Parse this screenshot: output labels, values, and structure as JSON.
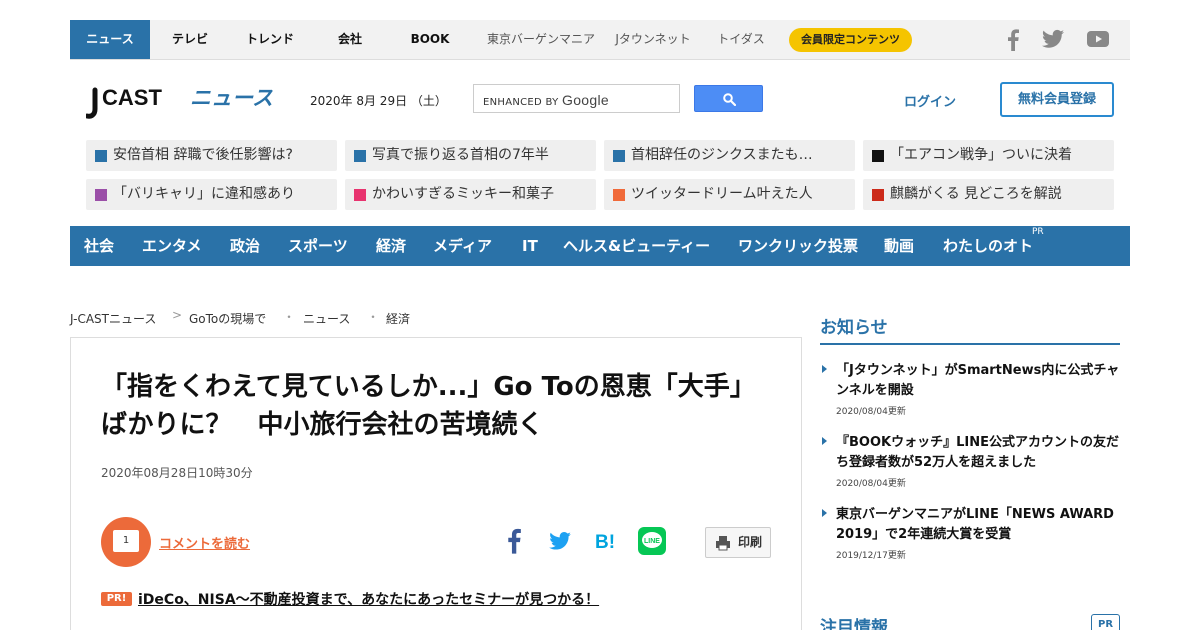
{
  "topnav": {
    "tabs": [
      "ニュース",
      "テレビ",
      "トレンド",
      "会社",
      "BOOK"
    ],
    "sites": [
      "東京バーゲンマニア",
      "Jタウンネット",
      "トイダス"
    ],
    "member_label": "会員限定コンテンツ",
    "social_icons": [
      "facebook-icon",
      "twitter-icon",
      "youtube-icon"
    ]
  },
  "header": {
    "logo_text": "CAST",
    "logo_suffix": "ニュース",
    "date": "2020年 8月 29日 （土）",
    "search_placeholder": "ENHANCED BY",
    "search_brand": "Google",
    "login": "ログイン",
    "register": "無料会員登録"
  },
  "topics": [
    {
      "label": "安倍首相 辞職で後任影響は?",
      "color": "#2a72a8"
    },
    {
      "label": "写真で振り返る首相の7年半",
      "color": "#2a72a8"
    },
    {
      "label": "首相辞任のジンクスまたも…",
      "color": "#2a72a8"
    },
    {
      "label": "「エアコン戦争」ついに決着",
      "color": "#111111"
    },
    {
      "label": "「バリキャリ」に違和感あり",
      "color": "#9b4fa8"
    },
    {
      "label": "かわいすぎるミッキー和菓子",
      "color": "#e8336f"
    },
    {
      "label": "ツイッタードリーム叶えた人",
      "color": "#f06a3a"
    },
    {
      "label": "麒麟がくる 見どころを解説",
      "color": "#cc2a1a"
    }
  ],
  "categories": [
    "社会",
    "エンタメ",
    "政治",
    "スポーツ",
    "経済",
    "メディア",
    "IT",
    "ヘルス&ビューティー",
    "ワンクリック投票",
    "動画",
    "わたしのオト"
  ],
  "categories_pr": "PR",
  "breadcrumb": [
    "J-CASTニュース",
    "GoToの現場で",
    "ニュース",
    "経済"
  ],
  "breadcrumb_seps": [
    ">",
    "・",
    "・"
  ],
  "article": {
    "title": "「指をくわえて見ているしか...」Go Toの恩恵「大手」ばかりに？　中小旅行会社の苦境続く",
    "date": "2020年08月28日10時30分",
    "comment_count": "1",
    "comment_link": "コメントを読む",
    "share_icons": [
      "facebook-share-icon",
      "twitter-share-icon",
      "hatena-bookmark-icon",
      "line-share-icon"
    ],
    "print_label": "印刷",
    "pr_badge": "PR!",
    "pr_link": "iDeCo、NISA～不動産投資まで、あなたにあったセミナーが見つかる！"
  },
  "sidebar": {
    "heading": "お知らせ",
    "items": [
      {
        "title": "「Jタウンネット」がSmartNews内に公式チャンネルを開設",
        "date": "2020/08/04更新"
      },
      {
        "title": "『BOOKウォッチ』LINE公式アカウントの友だち登録者数が52万人を超えました",
        "date": "2020/08/04更新"
      },
      {
        "title": "東京バーゲンマニアがLINE「NEWS AWARD 2019」で2年連続大賞を受賞",
        "date": "2019/12/17更新"
      }
    ],
    "heading2": "注目情報",
    "heading2_badge": "PR"
  },
  "colors": {
    "brand_blue": "#2a72a8",
    "accent_orange": "#ec6a3a",
    "member_yellow": "#f5c400",
    "google_blue": "#4d8df5"
  }
}
